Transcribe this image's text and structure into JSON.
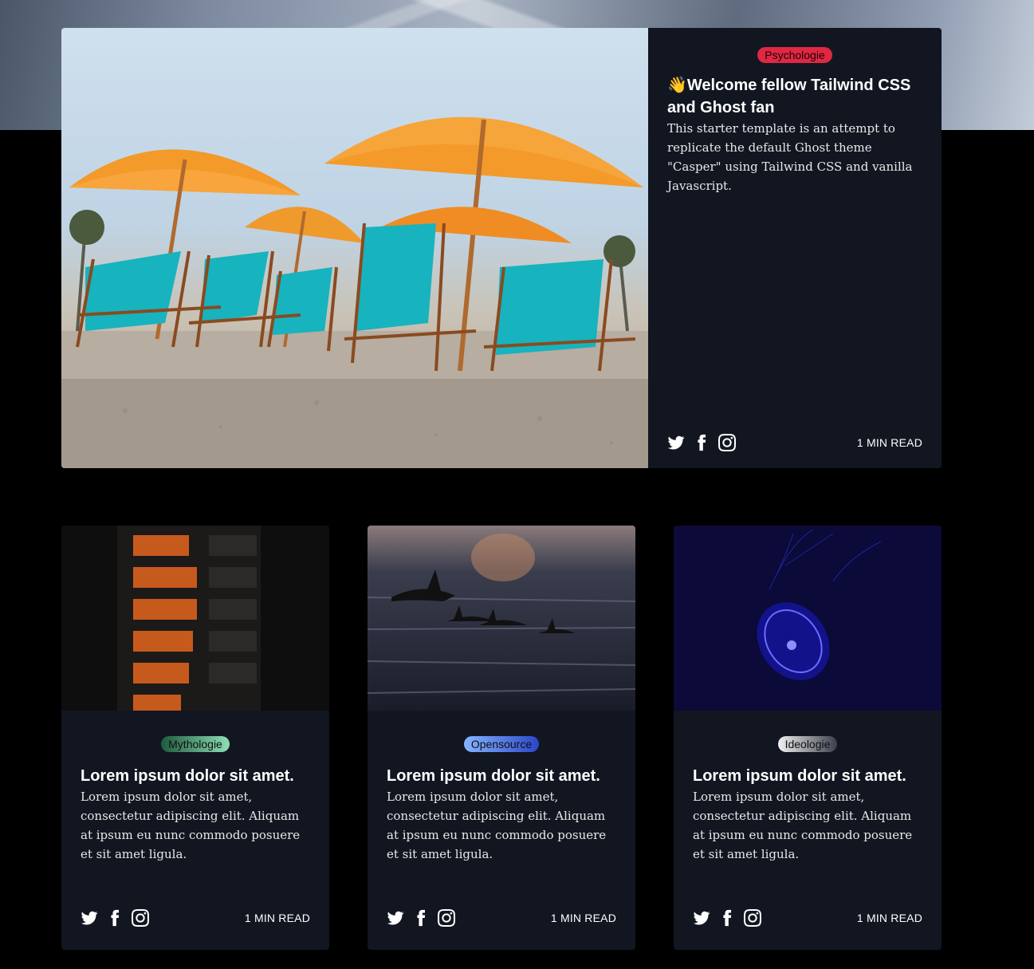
{
  "featured": {
    "tag": "Psychologie",
    "tag_color": "#e02843",
    "title": "👋Welcome fellow Tailwind CSS and Ghost fan",
    "excerpt": "This starter template is an attempt to replicate the default Ghost theme \"Casper\" using Tailwind CSS and vanilla Javascript.",
    "read_time": "1 MIN READ",
    "social": [
      "twitter-icon",
      "facebook-icon",
      "instagram-icon"
    ]
  },
  "cards": [
    {
      "tag": "Mythologie",
      "tag_gradient": [
        "#1f5b3f",
        "#8fe0b7"
      ],
      "title": "Lorem ipsum dolor sit amet.",
      "excerpt": "Lorem ipsum dolor sit amet, consectetur adipiscing elit. Aliquam at ipsum eu nunc commodo posuere et sit amet ligula.",
      "read_time": "1 MIN READ"
    },
    {
      "tag": "Opensource",
      "tag_gradient": [
        "#86b4ff",
        "#2b46c9"
      ],
      "title": "Lorem ipsum dolor sit amet.",
      "excerpt": "Lorem ipsum dolor sit amet, consectetur adipiscing elit. Aliquam at ipsum eu nunc commodo posuere et sit amet ligula.",
      "read_time": "1 MIN READ"
    },
    {
      "tag": "Ideologie",
      "tag_gradient": [
        "#f1f1f1",
        "#3a3f4a"
      ],
      "title": "Lorem ipsum dolor sit amet.",
      "excerpt": "Lorem ipsum dolor sit amet, consectetur adipiscing elit. Aliquam at ipsum eu nunc commodo posuere et sit amet ligula.",
      "read_time": "1 MIN READ"
    }
  ]
}
